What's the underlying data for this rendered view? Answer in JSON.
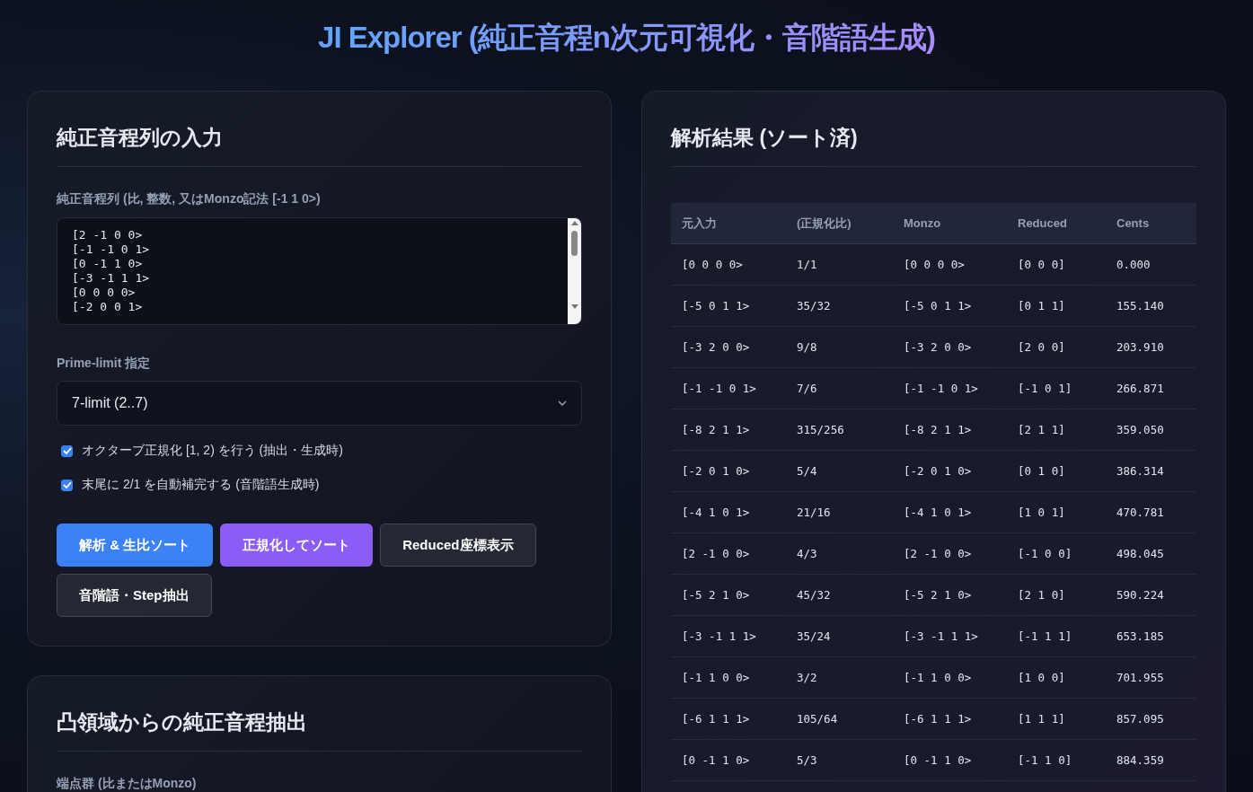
{
  "title": "JI Explorer (純正音程n次元可視化・音階語生成)",
  "input_card": {
    "heading": "純正音程列の入力",
    "sequence_label": "純正音程列 (比, 整数, 又はMonzo記法 [-1 1 0>)",
    "sequence_lines": [
      "[2 -1 0 0>",
      "[-1 -1 0 1>",
      "[0 -1 1 0>",
      "[-3 -1 1 1>",
      "[0 0 0 0>",
      "[-2 0 0 1>"
    ],
    "limit_label": "Prime-limit 指定",
    "limit_value": "7-limit (2..7)",
    "options": [
      {
        "label": "オクターブ正規化 [1, 2) を行う (抽出・生成時)",
        "checked": true
      },
      {
        "label": "末尾に 2/1 を自動補完する (音階語生成時)",
        "checked": true
      }
    ],
    "buttons": [
      {
        "label": "解析 & 生比ソート",
        "kind": "primary"
      },
      {
        "label": "正規化してソート",
        "kind": "accent"
      },
      {
        "label": "Reduced座標表示",
        "kind": "secondary"
      },
      {
        "label": "音階語・Step抽出",
        "kind": "secondary"
      }
    ]
  },
  "hull_card": {
    "heading": "凸領域からの純正音程抽出",
    "field_label": "端点群 (比またはMonzo)"
  },
  "results_card": {
    "heading": "解析結果 (ソート済)",
    "table": {
      "columns": [
        "元入力",
        "(正規化比)",
        "Monzo",
        "Reduced",
        "Cents"
      ],
      "rows": [
        [
          "[0 0 0 0>",
          "1/1",
          "[0 0 0 0>",
          "[0 0 0]",
          "0.000"
        ],
        [
          "[-5 0 1 1>",
          "35/32",
          "[-5 0 1 1>",
          "[0 1 1]",
          "155.140"
        ],
        [
          "[-3 2 0 0>",
          "9/8",
          "[-3 2 0 0>",
          "[2 0 0]",
          "203.910"
        ],
        [
          "[-1 -1 0 1>",
          "7/6",
          "[-1 -1 0 1>",
          "[-1 0 1]",
          "266.871"
        ],
        [
          "[-8 2 1 1>",
          "315/256",
          "[-8 2 1 1>",
          "[2 1 1]",
          "359.050"
        ],
        [
          "[-2 0 1 0>",
          "5/4",
          "[-2 0 1 0>",
          "[0 1 0]",
          "386.314"
        ],
        [
          "[-4 1 0 1>",
          "21/16",
          "[-4 1 0 1>",
          "[1 0 1]",
          "470.781"
        ],
        [
          "[2 -1 0 0>",
          "4/3",
          "[2 -1 0 0>",
          "[-1 0 0]",
          "498.045"
        ],
        [
          "[-5 2 1 0>",
          "45/32",
          "[-5 2 1 0>",
          "[2 1 0]",
          "590.224"
        ],
        [
          "[-3 -1 1 1>",
          "35/24",
          "[-3 -1 1 1>",
          "[-1 1 1]",
          "653.185"
        ],
        [
          "[-1 1 0 0>",
          "3/2",
          "[-1 1 0 0>",
          "[1 0 0]",
          "701.955"
        ],
        [
          "[-6 1 1 1>",
          "105/64",
          "[-6 1 1 1>",
          "[1 1 1]",
          "857.095"
        ],
        [
          "[0 -1 1 0>",
          "5/3",
          "[0 -1 1 0>",
          "[-1 1 0]",
          "884.359"
        ]
      ]
    }
  }
}
